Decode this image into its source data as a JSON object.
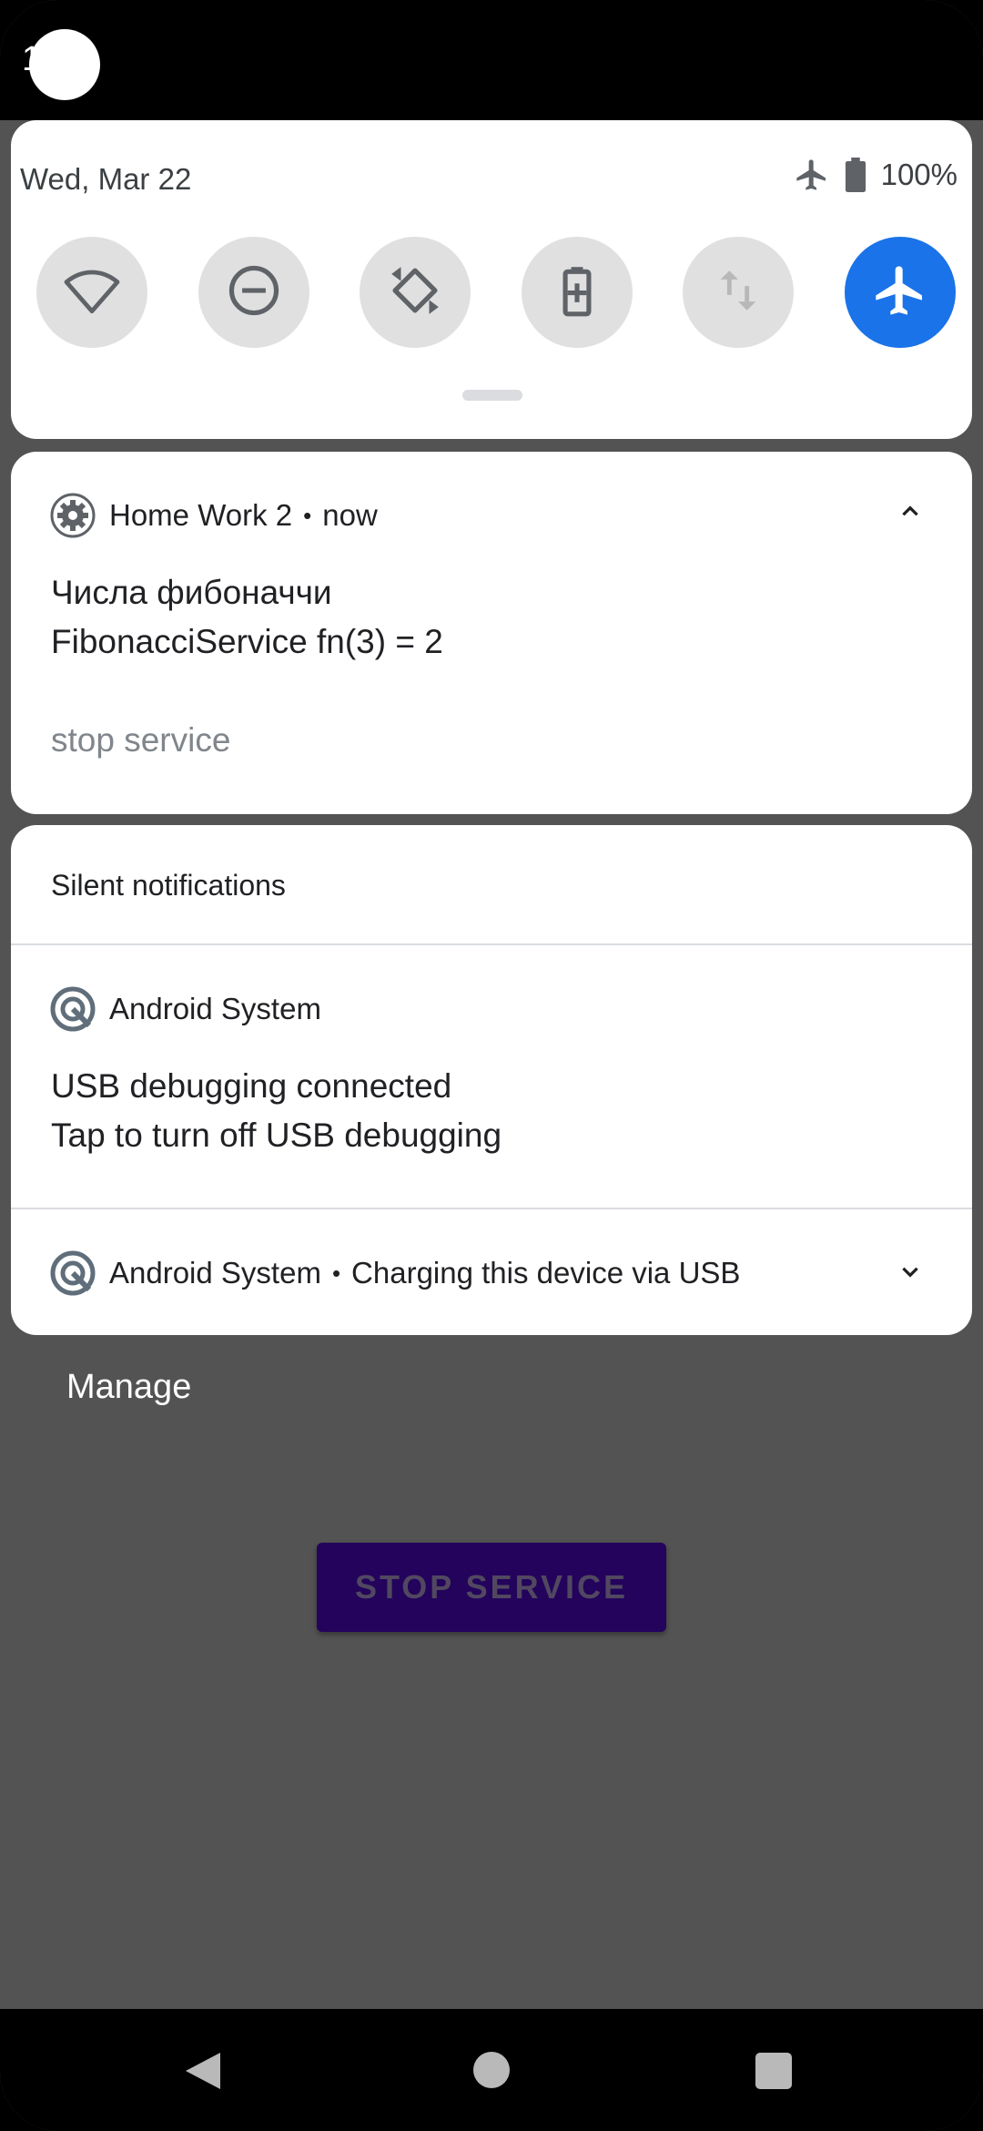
{
  "status_bar": {
    "time": "1   5"
  },
  "quick_settings": {
    "date": "Wed, Mar 22",
    "battery_level": "100%",
    "tiles": [
      {
        "name": "wifi",
        "active": false
      },
      {
        "name": "do-not-disturb",
        "active": false
      },
      {
        "name": "auto-rotate",
        "active": false
      },
      {
        "name": "battery-saver",
        "active": false
      },
      {
        "name": "mobile-data",
        "active": false
      },
      {
        "name": "airplane-mode",
        "active": true
      }
    ],
    "accent_color": "#1a73e8"
  },
  "notification_homework": {
    "app_name": "Home Work 2",
    "separator": "•",
    "time": "now",
    "title": "Числа фибоначчи",
    "text": "FibonacciService fn(3) = 2",
    "action": "stop service"
  },
  "silent_section": {
    "title": "Silent notifications",
    "usb_debug": {
      "app_name": "Android System",
      "title": "USB debugging connected",
      "text": "Tap to turn off USB debugging"
    },
    "charging": {
      "app_name": "Android System",
      "separator": "•",
      "summary": "Charging this device via USB"
    }
  },
  "manage_label": "Manage",
  "app_button_label": "STOP SERVICE"
}
